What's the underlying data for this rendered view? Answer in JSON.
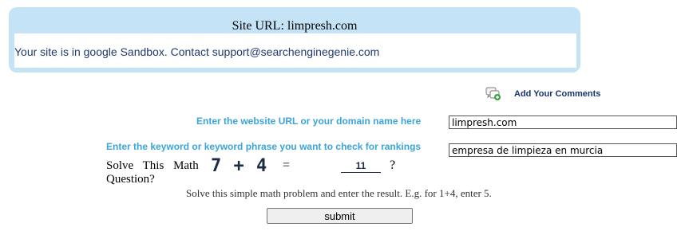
{
  "result": {
    "title": "Site URL: limpresh.com",
    "message": "Your site is in google Sandbox. Contact support@searchenginegenie.com"
  },
  "comments": {
    "icon": "comment-bubbles-icon",
    "link_label": "Add Your Comments"
  },
  "form": {
    "url_label": "Enter the website URL or your domain name here",
    "url_value": "limpresh.com",
    "keyword_label": "Enter the keyword or keyword phrase you want to check for rankings",
    "keyword_value": "empresa de limpieza en murcia",
    "math_label": "Solve This Math Question?",
    "captcha": "7 + 4",
    "equals": "=",
    "answer_value": "11",
    "question_mark": "?",
    "hint": "Solve this simple math problem and enter the result. E.g. for 1+4, enter 5.",
    "submit_label": "submit"
  },
  "colors": {
    "result_box": "#c5e3f7",
    "label_blue": "#3ba4d8",
    "link_navy": "#17356f"
  }
}
